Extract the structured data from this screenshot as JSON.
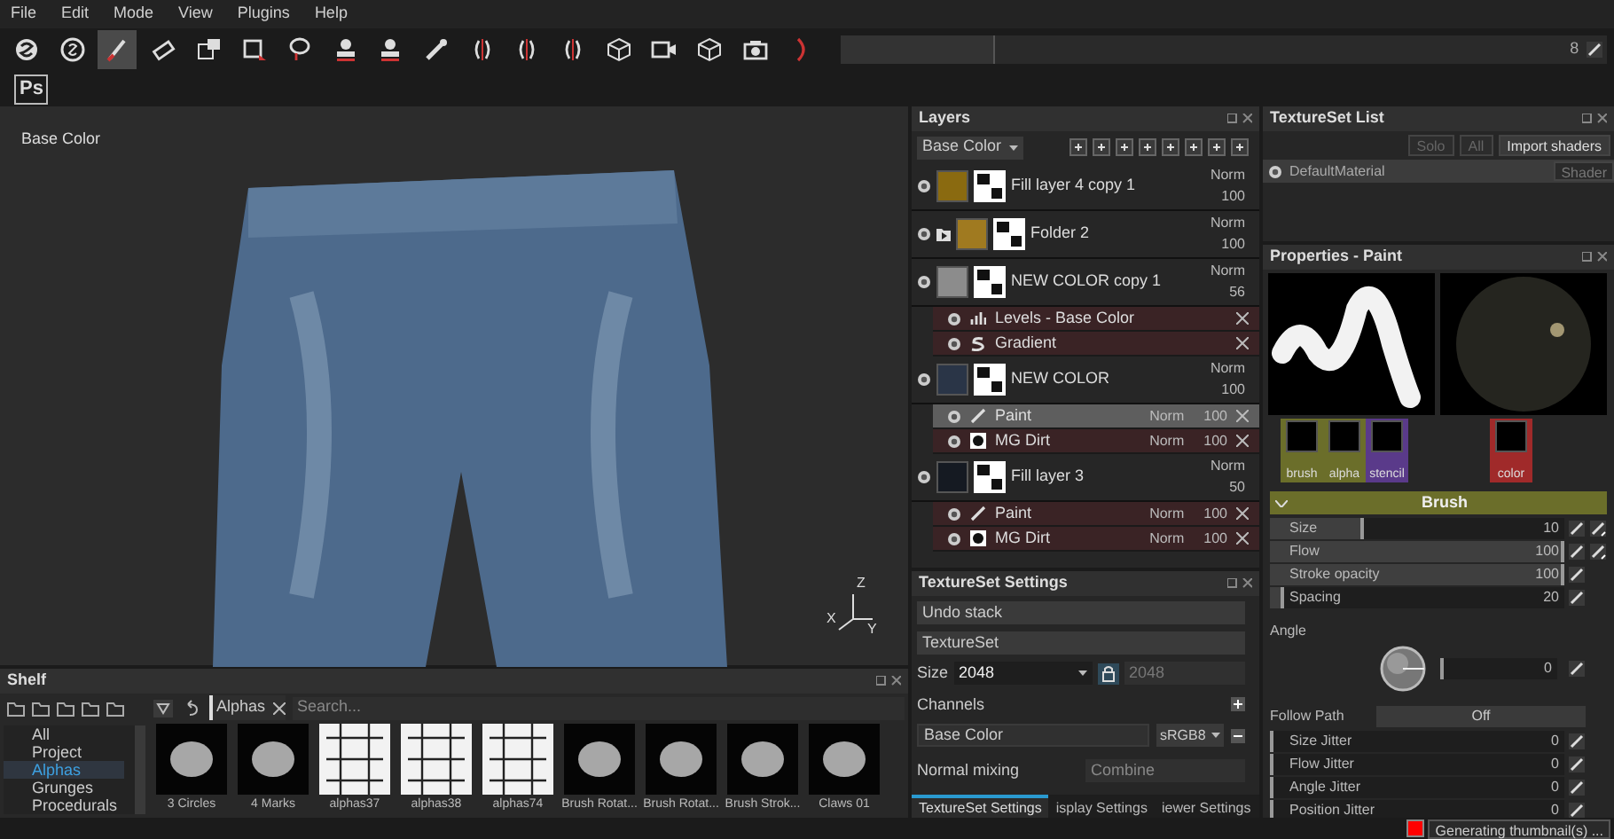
{
  "menu": [
    "File",
    "Edit",
    "Mode",
    "View",
    "Plugins",
    "Help"
  ],
  "toolbar": {
    "tools": [
      {
        "kind": "logo-s",
        "selected": false
      },
      {
        "kind": "circle-s",
        "selected": false
      },
      {
        "kind": "brush",
        "selected": true
      },
      {
        "kind": "eraser",
        "selected": false
      },
      {
        "kind": "projection",
        "selected": false
      },
      {
        "kind": "square",
        "selected": false
      },
      {
        "kind": "lasso",
        "selected": false
      },
      {
        "kind": "stamp",
        "selected": false
      },
      {
        "kind": "stamp",
        "selected": false
      },
      {
        "kind": "picker",
        "selected": false
      },
      {
        "kind": "symmetry",
        "selected": false
      },
      {
        "kind": "symmetry",
        "selected": false
      },
      {
        "kind": "symmetry",
        "selected": false
      },
      {
        "kind": "cube",
        "selected": false
      },
      {
        "kind": "camera",
        "selected": false
      },
      {
        "kind": "cube",
        "selected": false
      },
      {
        "kind": "photo",
        "selected": false
      },
      {
        "kind": "arc",
        "selected": false
      }
    ],
    "slider": {
      "value": "8",
      "level": 0.2
    }
  },
  "ps_button": "Ps",
  "viewport": {
    "label": "Base Color",
    "axes": [
      "Z",
      "X",
      "Y"
    ]
  },
  "layers": {
    "title": "Layers",
    "channel": "Base Color",
    "items": [
      {
        "kind": "fill",
        "name": "Fill layer 4 copy 1",
        "blend": "Norm",
        "opacity": "100",
        "visible": true,
        "color": "#8a6a10"
      },
      {
        "kind": "folder",
        "name": "Folder 2",
        "blend": "Norm",
        "opacity": "100",
        "visible": true,
        "color": "#a07a20"
      },
      {
        "kind": "fill",
        "name": "NEW COLOR copy 1",
        "blend": "Norm",
        "opacity": "56",
        "visible": true,
        "color": "#8c8c8c",
        "effects": [
          {
            "kind": "levels",
            "name": "Levels - Base Color",
            "selected": false
          },
          {
            "kind": "generator",
            "name": "Gradient",
            "selected": false
          }
        ]
      },
      {
        "kind": "fill",
        "name": "NEW COLOR",
        "blend": "Norm",
        "opacity": "100",
        "visible": true,
        "color": "#2a3547",
        "effects": [
          {
            "kind": "paint",
            "name": "Paint",
            "blend": "Norm",
            "opacity": "100",
            "selected": true
          },
          {
            "kind": "mask",
            "name": "MG Dirt",
            "blend": "Norm",
            "opacity": "100",
            "selected": false
          }
        ]
      },
      {
        "kind": "fill",
        "name": "Fill layer 3",
        "blend": "Norm",
        "opacity": "50",
        "visible": true,
        "color": "#151a22",
        "effects": [
          {
            "kind": "paint",
            "name": "Paint",
            "blend": "Norm",
            "opacity": "100",
            "selected": false
          },
          {
            "kind": "mask",
            "name": "MG Dirt",
            "blend": "Norm",
            "opacity": "100",
            "selected": false
          }
        ]
      }
    ]
  },
  "textureset_settings": {
    "title": "TextureSet Settings",
    "sections": [
      "Undo stack",
      "TextureSet"
    ],
    "size_label": "Size",
    "size": "2048",
    "size_locked": "2048",
    "channels_label": "Channels",
    "channel": "Base Color",
    "format": "sRGB8",
    "normal_label": "Normal mixing",
    "normal_value": "Combine",
    "tabs": [
      {
        "label": "TextureSet Settings",
        "selected": true
      },
      {
        "label": "isplay Settings",
        "selected": false
      },
      {
        "label": "iewer Settings",
        "selected": false
      }
    ]
  },
  "textureset_list": {
    "title": "TextureSet List",
    "buttons": [
      {
        "label": "Solo",
        "disabled": true
      },
      {
        "label": "All",
        "disabled": true
      },
      {
        "label": "Import shaders",
        "disabled": false
      }
    ],
    "materials": [
      {
        "name": "DefaultMaterial",
        "selected": true,
        "button": "Shader"
      }
    ]
  },
  "properties": {
    "title": "Properties - Paint",
    "slots": [
      {
        "label": "brush",
        "color": "#6b6e2a"
      },
      {
        "label": "alpha",
        "color": "#6b6e2a"
      },
      {
        "label": "stencil",
        "color": "#5a3a8a"
      },
      {
        "label": "color",
        "color": "#a02a2a"
      }
    ],
    "section": "Brush",
    "params": [
      {
        "kind": "slider",
        "label": "Size",
        "value": "10",
        "level": 0.32,
        "pressure": true
      },
      {
        "kind": "slider",
        "label": "Flow",
        "value": "100",
        "level": 1,
        "pressure": true
      },
      {
        "kind": "slider",
        "label": "Stroke opacity",
        "value": "100",
        "level": 1,
        "pressure": false
      },
      {
        "kind": "slider",
        "label": "Spacing",
        "value": "20",
        "level": 0.05,
        "pressure": false
      },
      {
        "kind": "angle",
        "label": "Angle",
        "value": "0"
      },
      {
        "kind": "toggle",
        "label": "Follow Path",
        "value": "Off"
      },
      {
        "kind": "slider",
        "label": "Size Jitter",
        "value": "0",
        "level": 0,
        "pressure": false
      },
      {
        "kind": "slider",
        "label": "Flow Jitter",
        "value": "0",
        "level": 0,
        "pressure": false
      },
      {
        "kind": "slider",
        "label": "Angle Jitter",
        "value": "0",
        "level": 0,
        "pressure": false
      },
      {
        "kind": "slider",
        "label": "Position Jitter",
        "value": "0",
        "level": 0,
        "pressure": false
      }
    ]
  },
  "shelf": {
    "title": "Shelf",
    "categories": [
      {
        "label": "All",
        "selected": false
      },
      {
        "label": "Project",
        "selected": false
      },
      {
        "label": "Alphas",
        "selected": true
      },
      {
        "label": "Grunges",
        "selected": false
      },
      {
        "label": "Procedurals",
        "selected": false
      }
    ],
    "filter": "Alphas",
    "search_placeholder": "Search...",
    "items": [
      {
        "kind": "dark",
        "label": "3 Circles"
      },
      {
        "kind": "dark",
        "label": "4 Marks"
      },
      {
        "kind": "light",
        "label": "alphas37"
      },
      {
        "kind": "light",
        "label": "alphas38"
      },
      {
        "kind": "light",
        "label": "alphas74"
      },
      {
        "kind": "dark",
        "label": "Brush Rotat..."
      },
      {
        "kind": "dark",
        "label": "Brush Rotat..."
      },
      {
        "kind": "dark",
        "label": "Brush Strok..."
      },
      {
        "kind": "dark",
        "label": "Claws 01"
      }
    ]
  },
  "status": "Generating thumbnail(s) ..."
}
